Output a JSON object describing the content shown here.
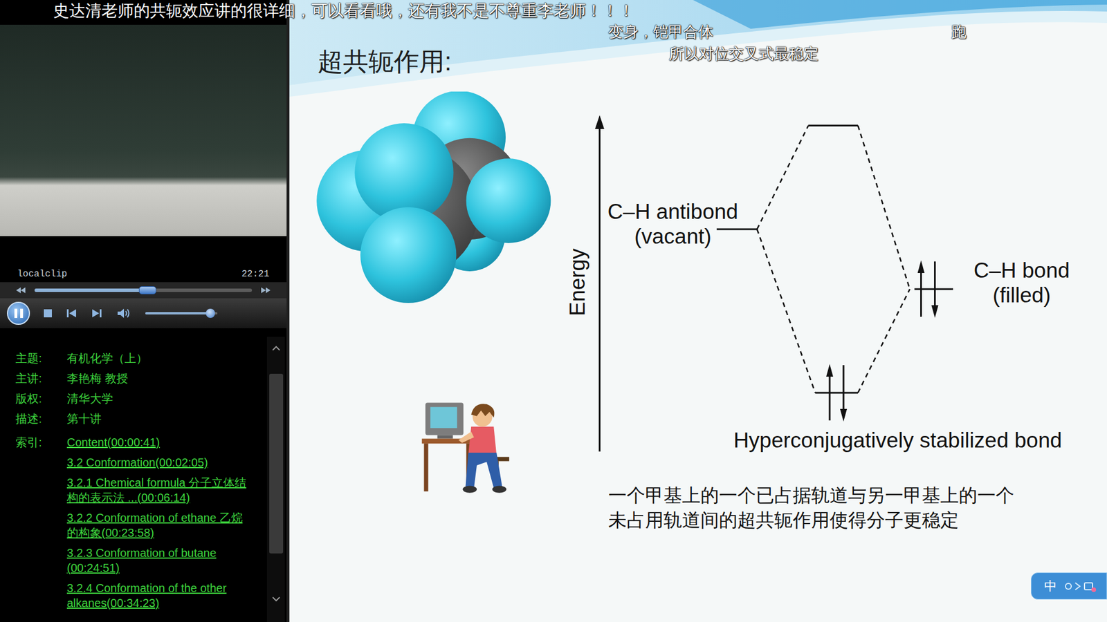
{
  "danmaku": [
    {
      "text": "史达清老师的共轭效应讲的很详细，可以看看哦，还有我不是不尊重李老师！！！"
    },
    {
      "text": "变身，铠甲合体"
    },
    {
      "text": "跑"
    },
    {
      "text": "所以对位交叉式最稳定"
    }
  ],
  "player": {
    "clip_name": "localclip",
    "time": "22:21",
    "playing": true,
    "progress": {
      "level": 0.52
    },
    "volume": {
      "level": 0.9
    }
  },
  "info": {
    "rows": [
      {
        "label": "主题:",
        "value": "有机化学（上）"
      },
      {
        "label": "主讲:",
        "value": "李艳梅 教授"
      },
      {
        "label": "版权:",
        "value": "清华大学"
      },
      {
        "label": "描述:",
        "value": "第十讲"
      }
    ],
    "index": {
      "label": "索引:",
      "entries": [
        "Content(00:00:41)",
        "3.2 Conformation(00:02:05)",
        "3.2.1 Chemical formula 分子立体结构的表示法 ...(00:06:14)",
        "3.2.2 Conformation of ethane 乙烷的构象(00:23:58)",
        "3.2.3 Conformation of butane (00:24:51)",
        "3.2.4 Conformation of the other alkanes(00:34:23)"
      ]
    }
  },
  "slide": {
    "title": "超共轭作用:",
    "diagram": {
      "axis_label": "Energy",
      "antibond": {
        "lines": [
          "C–H antibond",
          "(vacant)"
        ],
        "electrons": 0
      },
      "bond": {
        "lines": [
          "C–H bond",
          "(filled)"
        ],
        "electrons": 2
      },
      "upper": {
        "electrons": 0
      },
      "stabilized": {
        "label": "Hyperconjugatively stabilized bond",
        "electrons": 2
      }
    },
    "caption_lines": [
      "一个甲基上的一个已占据轨道与另一甲基上的一个",
      "未占用轨道间的超共轭作用使得分子更稳定"
    ]
  },
  "badge": {
    "text": "中"
  }
}
